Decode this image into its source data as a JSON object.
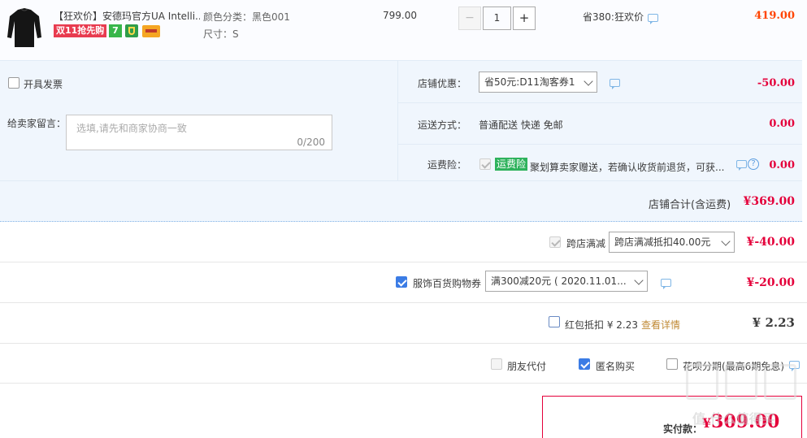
{
  "product": {
    "title": "【狂欢价】安德玛官方UA Intelli...",
    "badge_promo": "双11抢先购",
    "badge_seven": "7",
    "color_label": "颜色分类：黑色001",
    "size_label": "尺寸：S",
    "unit_price": "799.00",
    "quantity": "1",
    "qty_minus": "−",
    "qty_plus": "+",
    "discount_text": "省380:狂欢价",
    "subtotal": "419.00"
  },
  "order_form": {
    "invoice_label": "开具发票",
    "message_label": "给卖家留言：",
    "message_placeholder": "选填,请先和商家协商一致",
    "message_counter": "0/200"
  },
  "shop_promo": {
    "label": "店铺优惠：",
    "selected": "省50元:D11淘客券1",
    "amount": "-50.00"
  },
  "shipping": {
    "label": "运送方式：",
    "value": "普通配送 快递 免邮",
    "amount": "0.00"
  },
  "insurance": {
    "label": "运费险：",
    "badge": "运费险",
    "text": "聚划算卖家赠送，若确认收货前退货，可获...",
    "amount": "0.00"
  },
  "shop_total": {
    "label": "店铺合计(含运费)",
    "amount": "¥369.00"
  },
  "cross_store": {
    "label": "跨店满减",
    "selected": "跨店满减抵扣40.00元",
    "amount": "¥-40.00"
  },
  "coupon": {
    "label": "服饰百货购物券",
    "selected": "满300减20元 ( 2020.11.01...",
    "amount": "¥-20.00"
  },
  "red_packet": {
    "label": "红包抵扣 ¥ 2.23",
    "detail_link": "查看详情",
    "amount": "¥ 2.23"
  },
  "options": {
    "friend_pay": "朋友代付",
    "anonymous": "匿名购买",
    "huabei": "花呗分期(最高6期免息)"
  },
  "payment": {
    "label": "实付款：",
    "amount": "309.00"
  },
  "watermark": "值 什么值得买",
  "colors": {
    "accent_red": "#f40",
    "amount_red": "#e4003a",
    "check_blue": "#3b7ce5",
    "panel_bg": "#f0f6fd",
    "badge_green": "#2eb25c"
  }
}
